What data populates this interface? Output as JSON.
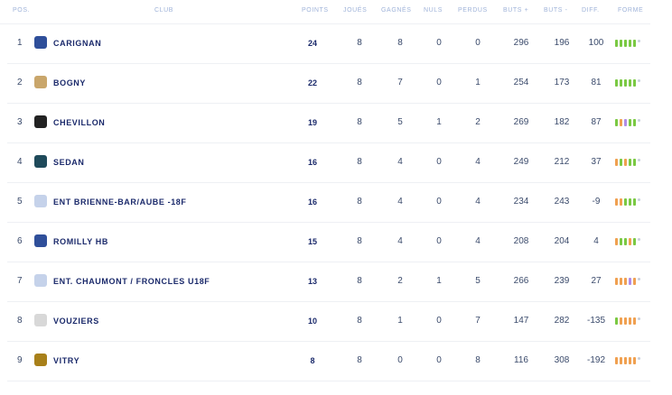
{
  "headers": {
    "pos": "POS.",
    "club": "CLUB",
    "points": "POINTS",
    "joues": "JOUÉS",
    "gagnes": "GAGNÉS",
    "nuls": "NULS",
    "perdus": "PERDUS",
    "buts_plus": "BUTS +",
    "buts_minus": "BUTS -",
    "diff": "DIFF.",
    "forme": "FORME"
  },
  "colors": {
    "win": "#7ac943",
    "draw": "#f0a050",
    "loss": "#f0a050",
    "mixed_a": "#9b8cf0",
    "header": "#9fb3d9",
    "club": "#1b2a6b"
  },
  "rows": [
    {
      "pos": "1",
      "club": "CARIGNAN",
      "points": "24",
      "joues": "8",
      "gagnes": "8",
      "nuls": "0",
      "perdus": "0",
      "buts_plus": "296",
      "buts_minus": "196",
      "diff": "100",
      "logo_color": "#2f4f9a",
      "forme": [
        "#7ac943",
        "#7ac943",
        "#7ac943",
        "#7ac943",
        "#7ac943"
      ]
    },
    {
      "pos": "2",
      "club": "BOGNY",
      "points": "22",
      "joues": "8",
      "gagnes": "7",
      "nuls": "0",
      "perdus": "1",
      "buts_plus": "254",
      "buts_minus": "173",
      "diff": "81",
      "logo_color": "#c9a66b",
      "forme": [
        "#7ac943",
        "#7ac943",
        "#7ac943",
        "#7ac943",
        "#7ac943"
      ]
    },
    {
      "pos": "3",
      "club": "CHEVILLON",
      "points": "19",
      "joues": "8",
      "gagnes": "5",
      "nuls": "1",
      "perdus": "2",
      "buts_plus": "269",
      "buts_minus": "182",
      "diff": "87",
      "logo_color": "#222222",
      "forme": [
        "#7ac943",
        "#f0a050",
        "#b08ce8",
        "#7ac943",
        "#7ac943"
      ]
    },
    {
      "pos": "4",
      "club": "SEDAN",
      "points": "16",
      "joues": "8",
      "gagnes": "4",
      "nuls": "0",
      "perdus": "4",
      "buts_plus": "249",
      "buts_minus": "212",
      "diff": "37",
      "logo_color": "#1f4a5a",
      "forme": [
        "#f0a050",
        "#7ac943",
        "#f0a050",
        "#7ac943",
        "#7ac943"
      ]
    },
    {
      "pos": "5",
      "club": "ENT BRIENNE-BAR/AUBE -18F",
      "points": "16",
      "joues": "8",
      "gagnes": "4",
      "nuls": "0",
      "perdus": "4",
      "buts_plus": "234",
      "buts_minus": "243",
      "diff": "-9",
      "logo_color": "#c5d2ea",
      "forme": [
        "#f0a050",
        "#f0a050",
        "#7ac943",
        "#7ac943",
        "#7ac943"
      ]
    },
    {
      "pos": "6",
      "club": "ROMILLY HB",
      "points": "15",
      "joues": "8",
      "gagnes": "4",
      "nuls": "0",
      "perdus": "4",
      "buts_plus": "208",
      "buts_minus": "204",
      "diff": "4",
      "logo_color": "#2f4f9a",
      "forme": [
        "#f0a050",
        "#7ac943",
        "#7ac943",
        "#f0a050",
        "#7ac943"
      ]
    },
    {
      "pos": "7",
      "club": "ENT. CHAUMONT / FRONCLES U18F",
      "points": "13",
      "joues": "8",
      "gagnes": "2",
      "nuls": "1",
      "perdus": "5",
      "buts_plus": "266",
      "buts_minus": "239",
      "diff": "27",
      "logo_color": "#c5d2ea",
      "forme": [
        "#f0a050",
        "#f0a050",
        "#f0a050",
        "#b08ce8",
        "#f0a050"
      ]
    },
    {
      "pos": "8",
      "club": "VOUZIERS",
      "points": "10",
      "joues": "8",
      "gagnes": "1",
      "nuls": "0",
      "perdus": "7",
      "buts_plus": "147",
      "buts_minus": "282",
      "diff": "-135",
      "logo_color": "#d8d8d8",
      "forme": [
        "#7ac943",
        "#f0a050",
        "#f0a050",
        "#f0a050",
        "#f0a050"
      ]
    },
    {
      "pos": "9",
      "club": "VITRY",
      "points": "8",
      "joues": "8",
      "gagnes": "0",
      "nuls": "0",
      "perdus": "8",
      "buts_plus": "116",
      "buts_minus": "308",
      "diff": "-192",
      "logo_color": "#a8801a",
      "forme": [
        "#f0a050",
        "#f0a050",
        "#f0a050",
        "#f0a050",
        "#f0a050"
      ]
    }
  ]
}
